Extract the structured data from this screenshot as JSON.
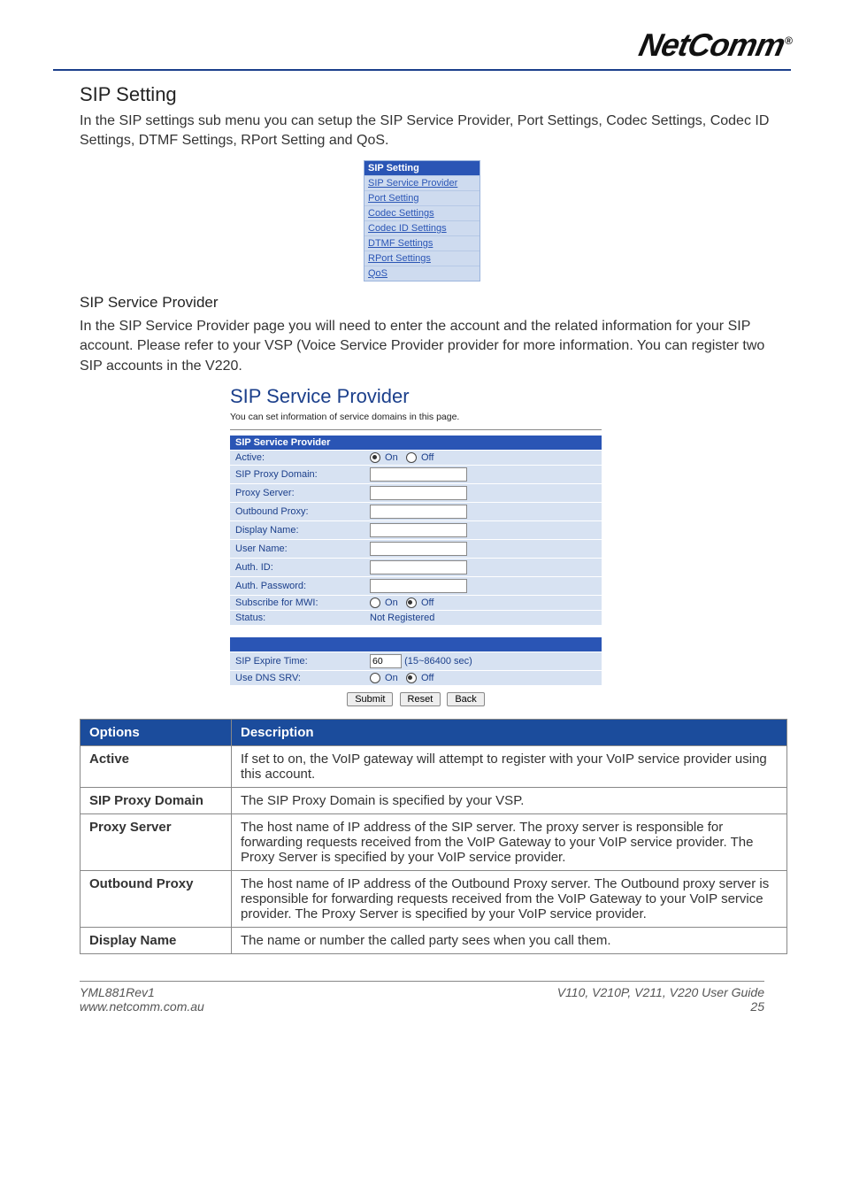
{
  "brand": "NetComm",
  "reg": "®",
  "section_title": "SIP Setting",
  "intro": "In the SIP settings sub menu you can setup the SIP Service Provider, Port Settings, Codec Settings, Codec ID Settings, DTMF Settings, RPort Setting and QoS.",
  "menu": {
    "header": "SIP Setting",
    "items": [
      "SIP Service Provider",
      "Port Setting",
      "Codec Settings",
      "Codec ID Settings",
      "DTMF Settings",
      "RPort Settings",
      "QoS"
    ]
  },
  "subhead": "SIP Service Provider",
  "sub_intro": "In the SIP Service Provider page you will need to enter the account and the related information for your SIP account. Please refer to your VSP (Voice Service Provider provider for more information. You can register two SIP accounts in the V220.",
  "form": {
    "title": "SIP Service Provider",
    "note": "You can set information of service domains in this page.",
    "header1": "SIP Service Provider",
    "rows": [
      {
        "label": "Active:",
        "type": "radio",
        "on": true
      },
      {
        "label": "SIP Proxy Domain:",
        "type": "text"
      },
      {
        "label": "Proxy Server:",
        "type": "text"
      },
      {
        "label": "Outbound Proxy:",
        "type": "text"
      },
      {
        "label": "Display Name:",
        "type": "text"
      },
      {
        "label": "User Name:",
        "type": "text"
      },
      {
        "label": "Auth. ID:",
        "type": "text"
      },
      {
        "label": "Auth. Password:",
        "type": "text"
      },
      {
        "label": "Subscribe for MWI:",
        "type": "radio",
        "on": false
      },
      {
        "label": "Status:",
        "type": "status",
        "text": "Not Registered"
      }
    ],
    "rows2": [
      {
        "label": "SIP Expire Time:",
        "type": "num",
        "value": "60",
        "hint": "(15~86400 sec)"
      },
      {
        "label": "Use DNS SRV:",
        "type": "radio",
        "on": false
      }
    ],
    "on_label": "On",
    "off_label": "Off",
    "buttons": [
      "Submit",
      "Reset",
      "Back"
    ]
  },
  "options_table": {
    "head": [
      "Options",
      "Description"
    ],
    "rows": [
      [
        "Active",
        "If set to on, the VoIP gateway will attempt to register with your VoIP service provider using this account."
      ],
      [
        "SIP Proxy Domain",
        "The SIP Proxy Domain is specified by your VSP."
      ],
      [
        "Proxy Server",
        "The host name of IP address of the SIP server. The proxy server is responsible for forwarding requests received from the VoIP Gateway to your VoIP service provider. The Proxy Server is specified by your VoIP service provider."
      ],
      [
        "Outbound Proxy",
        "The host name of IP address of the Outbound Proxy server. The Outbound proxy server is responsible for forwarding requests received from the VoIP Gateway to your VoIP service provider. The Proxy Server is specified by your VoIP service provider."
      ],
      [
        "Display Name",
        "The name or number the called party sees when you call them."
      ]
    ]
  },
  "footer": {
    "left1": "YML881Rev1",
    "left2": "www.netcomm.com.au",
    "right1": "V110, V210P, V211, V220 User Guide",
    "right2": "25"
  }
}
